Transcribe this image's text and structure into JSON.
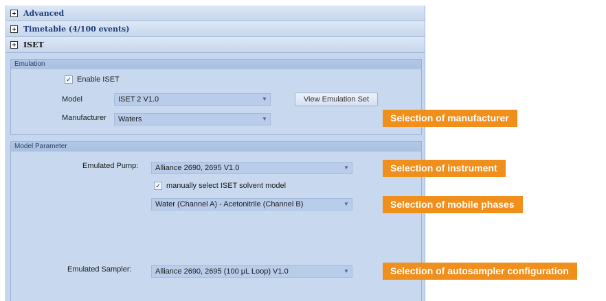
{
  "sections": {
    "advanced": "Advanced",
    "timetable": "Timetable (4/100 events)",
    "iset": "ISET"
  },
  "emulation": {
    "title": "Emulation",
    "enable_label": "Enable ISET",
    "enable_checked": true,
    "model_label": "Model",
    "model_value": "ISET 2 V1.0",
    "view_button": "View Emulation Set",
    "manufacturer_label": "Manufacturer",
    "manufacturer_value": "Waters"
  },
  "model_parameter": {
    "title": "Model Parameter",
    "pump_label": "Emulated Pump:",
    "pump_value": "Alliance 2690, 2695 V1.0",
    "solvent_checkbox_label": "manually select ISET solvent model",
    "solvent_checked": true,
    "solvent_value": "Water (Channel A) - Acetonitrile (Channel B)",
    "sampler_label": "Emulated Sampler:",
    "sampler_value": "Alliance 2690, 2695 (100 µL Loop) V1.0"
  },
  "callouts": {
    "manufacturer": "Selection of manufacturer",
    "instrument": "Selection of instrument",
    "mobile_phases": "Selection of mobile phases",
    "autosampler": "Selection of autosampler configuration"
  },
  "icons": {
    "expander": "plus-expander-icon",
    "dropdown": "dropdown-arrow-icon",
    "check": "checkmark-icon"
  },
  "colors": {
    "panel_bg": "#c5d7ee",
    "callout_bg": "#f18f1c"
  }
}
